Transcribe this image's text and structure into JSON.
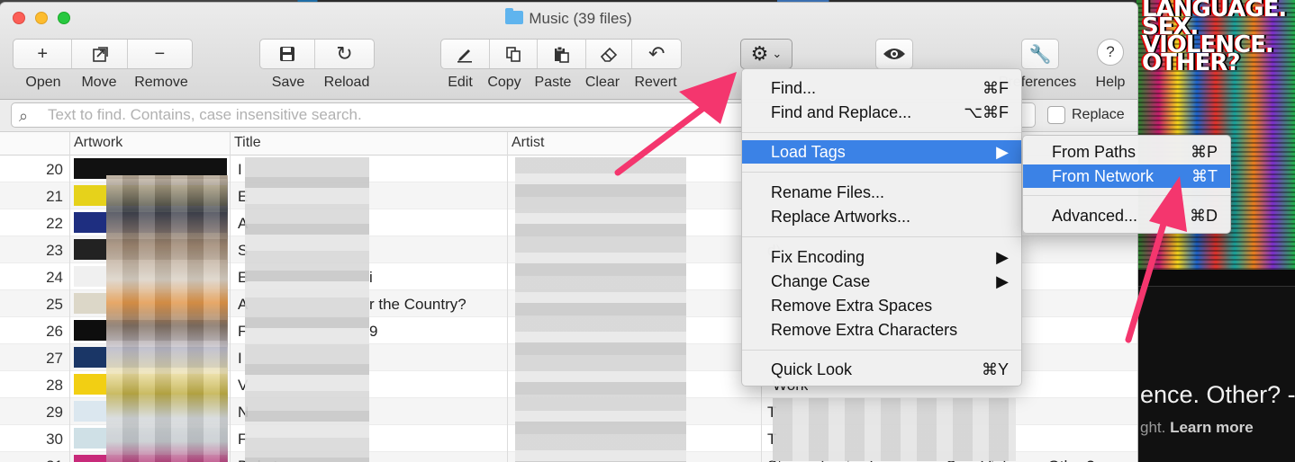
{
  "window": {
    "title": "Music (39 files)"
  },
  "toolbar": {
    "open": "Open",
    "move": "Move",
    "remove": "Remove",
    "save": "Save",
    "reload": "Reload",
    "edit": "Edit",
    "copy": "Copy",
    "paste": "Paste",
    "clear": "Clear",
    "revert": "Revert",
    "preferences": "Preferences",
    "help": "Help",
    "icons": [
      "plus-icon",
      "move-icon",
      "minus-icon",
      "save-icon",
      "reload-icon",
      "pencil-icon",
      "copy-icon",
      "paste-icon",
      "eraser-icon",
      "revert-icon",
      "gear-icon",
      "eye-icon",
      "wrench-icon",
      "help-icon"
    ]
  },
  "search": {
    "placeholder": "Text to find. Contains, case insensitive search.",
    "value": "",
    "replace_label": "Replace",
    "replace_checked": false
  },
  "table": {
    "columns": [
      "Artwork",
      "Title",
      "Artist"
    ],
    "rows": [
      {
        "num": "20",
        "title": "I",
        "artist": ""
      },
      {
        "num": "21",
        "title": "E",
        "artist": ""
      },
      {
        "num": "22",
        "title": "A",
        "artist": ""
      },
      {
        "num": "23",
        "title": "S",
        "artist": "d)"
      },
      {
        "num": "24",
        "title": "E",
        "artist": ""
      },
      {
        "num": "25",
        "title": "A",
        "artist": ""
      },
      {
        "num": "26",
        "title": "F",
        "artist": ""
      },
      {
        "num": "27",
        "title": "I",
        "artist": ""
      },
      {
        "num": "28",
        "title": "V",
        "artist": ""
      },
      {
        "num": "29",
        "title": "N",
        "artist": "T"
      },
      {
        "num": "30",
        "title": "F",
        "artist": "T"
      },
      {
        "num": "31",
        "title": "Dakota",
        "artist": "Stereophonics Language. Sex. Violence. Other?"
      }
    ],
    "fragments": {
      "row24": "i",
      "row25": "r the Country?",
      "row26": "9",
      "row28": "Work"
    }
  },
  "menu": {
    "items": [
      {
        "label": "Find...",
        "shortcut": "⌘F"
      },
      {
        "label": "Find and Replace...",
        "shortcut": "⌥⌘F"
      },
      {
        "label": "Load Tags",
        "shortcut": "▶"
      },
      {
        "label": "Rename Files...",
        "shortcut": ""
      },
      {
        "label": "Replace Artworks...",
        "shortcut": ""
      },
      {
        "label": "Fix Encoding",
        "shortcut": "▶"
      },
      {
        "label": "Change Case",
        "shortcut": "▶"
      },
      {
        "label": "Remove Extra Spaces",
        "shortcut": ""
      },
      {
        "label": "Remove Extra Characters",
        "shortcut": ""
      },
      {
        "label": "Quick Look",
        "shortcut": "⌘Y"
      }
    ],
    "active_item": "Load Tags",
    "submenu": [
      {
        "label": "From Paths",
        "shortcut": "⌘P"
      },
      {
        "label": "From Network",
        "shortcut": "⌘T"
      },
      {
        "label": "Advanced...",
        "shortcut": "⌘D"
      }
    ],
    "submenu_active": "From Network",
    "highlight_color": "#3b82e6"
  },
  "background": {
    "glitch_text": "LANGUAGE. SEX. VIOLENCE. OTHER?",
    "big_text": "ence. Other? -",
    "small_text": "ght.",
    "small_link": "Learn more"
  },
  "annotation_color": "#f4366e"
}
